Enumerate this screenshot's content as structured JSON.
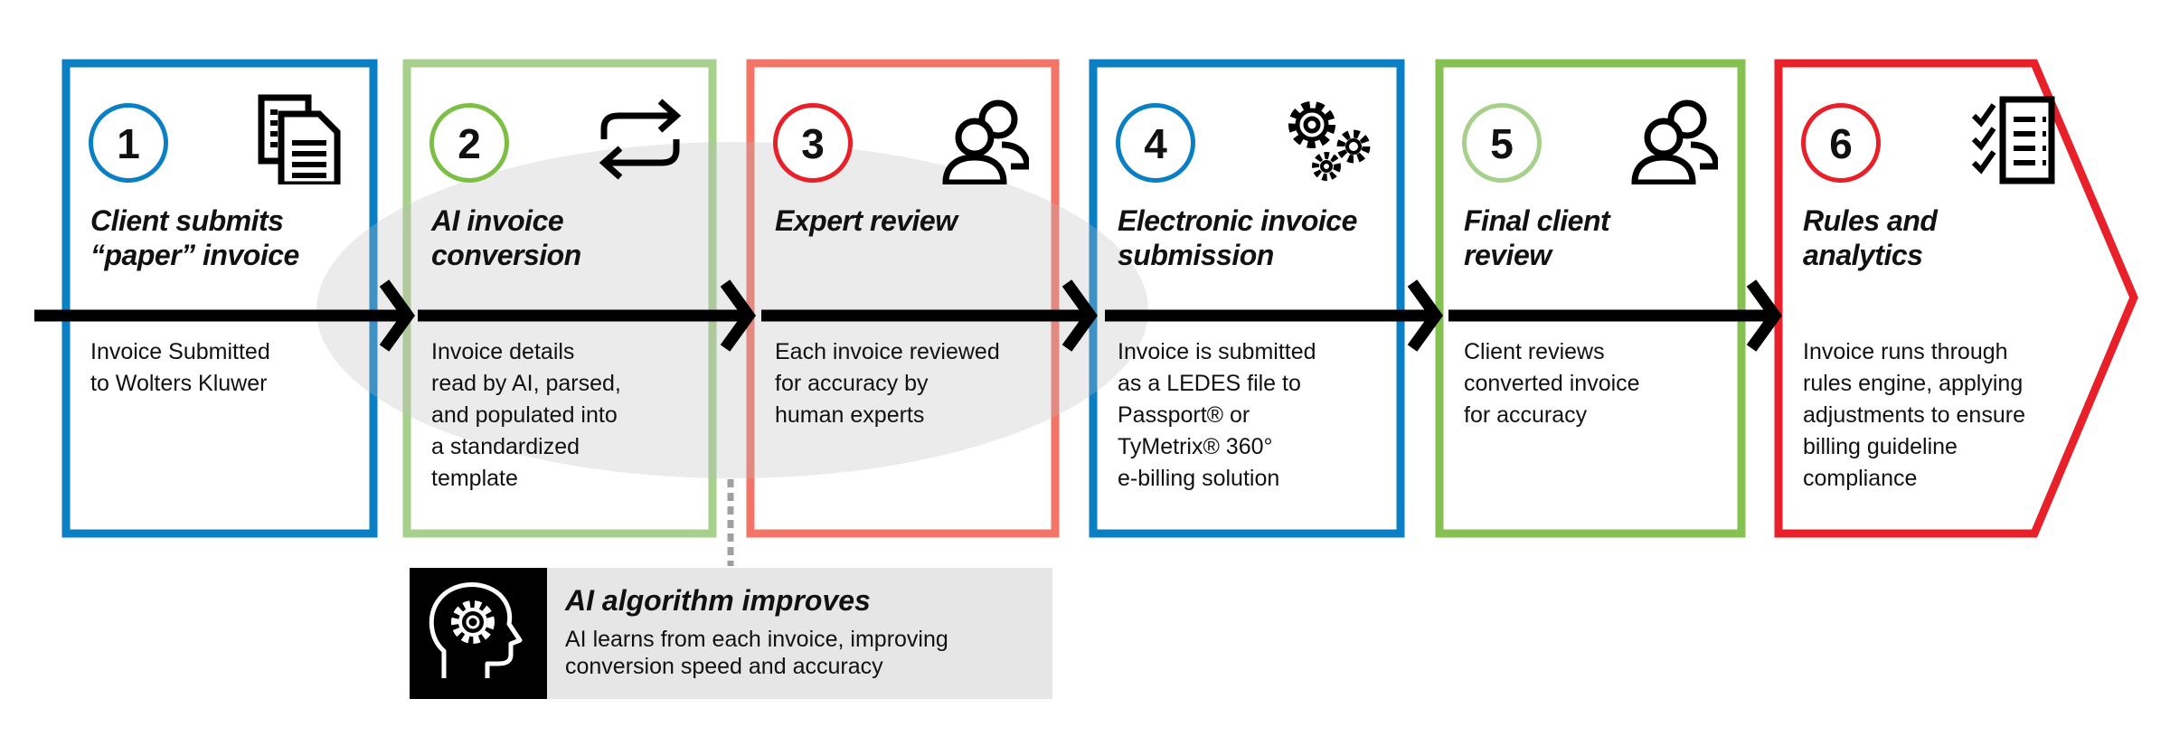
{
  "colors": {
    "blue": "#0a7fc4",
    "light_green": "#a8d08d",
    "salmon": "#f27568",
    "green": "#85c150",
    "red": "#e8202a",
    "panel_gray": "#e6e6e7"
  },
  "steps": [
    {
      "number": "1",
      "title": "Client submits\n“paper” invoice",
      "body": "Invoice Submitted\nto Wolters Kluwer",
      "icon": "documents-icon",
      "box_color": "#0a7fc4",
      "circle_color": "#0a7fc4"
    },
    {
      "number": "2",
      "title": "AI invoice\nconversion",
      "body": "Invoice details\nread by AI, parsed,\nand populated into\na standardized\ntemplate",
      "icon": "convert-arrows-icon",
      "box_color": "#a8d08d",
      "circle_color": "#7dbf45"
    },
    {
      "number": "3",
      "title": "Expert review",
      "body": "Each invoice reviewed\nfor accuracy by\nhuman experts",
      "icon": "people-icon",
      "box_color": "#f27568",
      "circle_color": "#e8202a"
    },
    {
      "number": "4",
      "title": "Electronic invoice\nsubmission",
      "body": "Invoice is submitted\nas a LEDES file to\nPassport® or\nTyMetrix® 360°\ne-billing solution",
      "icon": "gears-icon",
      "box_color": "#0a7fc4",
      "circle_color": "#0a7fc4"
    },
    {
      "number": "5",
      "title": "Final client\nreview",
      "body": "Client reviews\nconverted invoice\nfor accuracy",
      "icon": "people-icon",
      "box_color": "#85c150",
      "circle_color": "#a8d08d"
    },
    {
      "number": "6",
      "title": "Rules and\nanalytics",
      "body": "Invoice runs through\nrules engine, applying\nadjustments to ensure\nbilling guideline\ncompliance",
      "icon": "checklist-icon",
      "box_color": "#e8202a",
      "circle_color": "#e8202a"
    }
  ],
  "ai_panel": {
    "title": "AI algorithm improves",
    "body": "AI learns from each invoice, improving\nconversion speed and accuracy",
    "icon": "head-gear-icon"
  }
}
